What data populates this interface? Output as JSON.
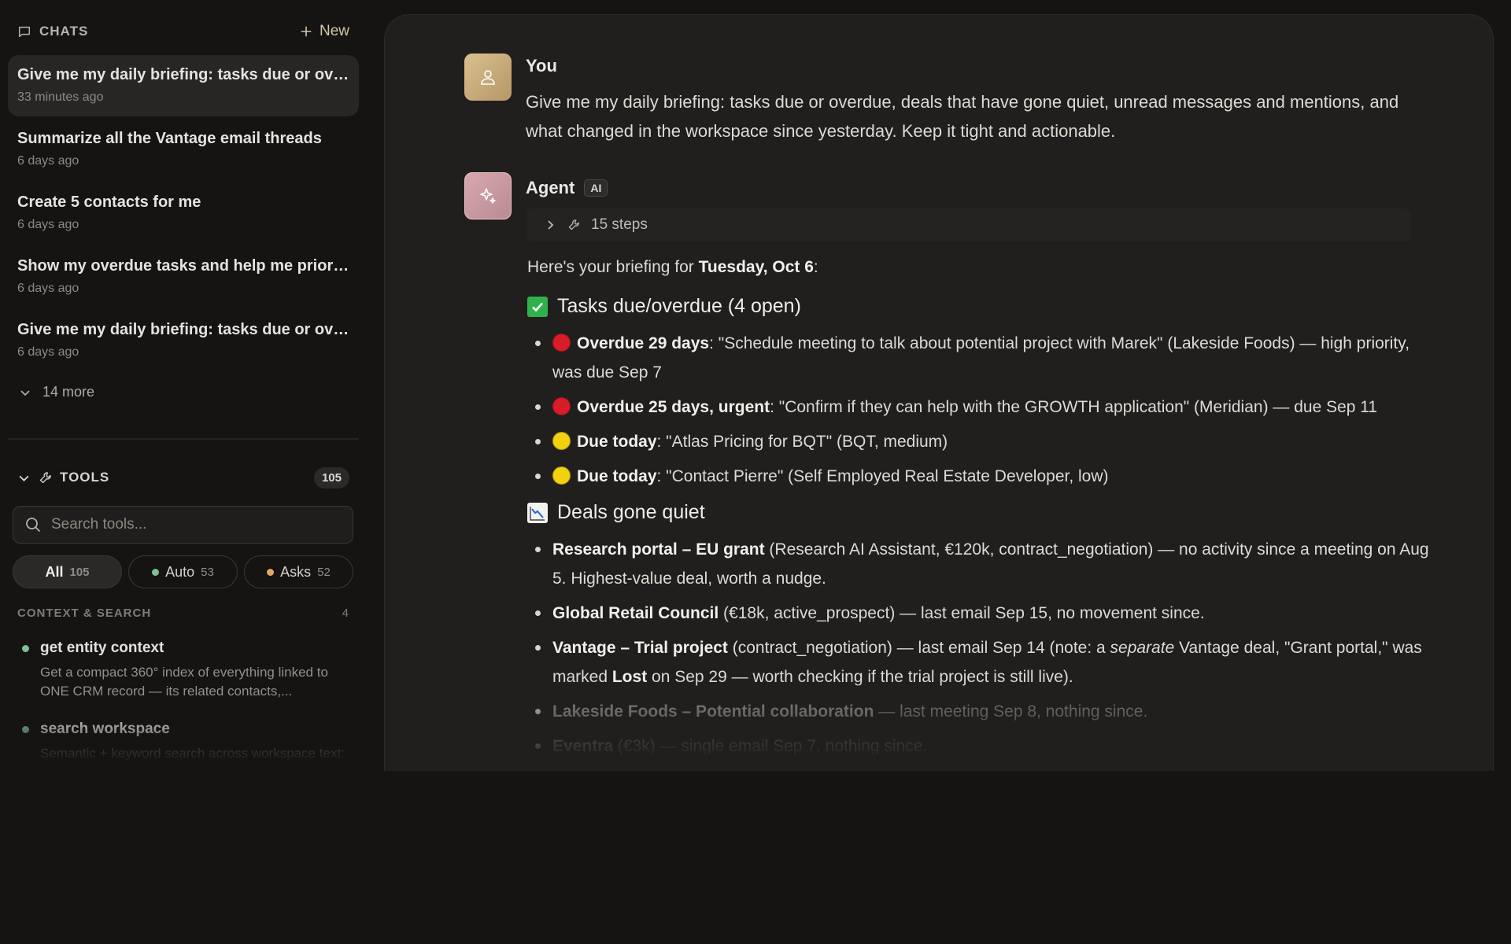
{
  "sidebar": {
    "chats_title": "CHATS",
    "new_label": "New",
    "chats": [
      {
        "title": "Give me my daily briefing: tasks due or ove...",
        "time": "33 minutes ago",
        "active": true
      },
      {
        "title": "Summarize all the Vantage email threads",
        "time": "6 days ago"
      },
      {
        "title": "Create 5 contacts for me",
        "time": "6 days ago"
      },
      {
        "title": "Show my overdue tasks and help me priori...",
        "time": "6 days ago"
      },
      {
        "title": "Give me my daily briefing: tasks due or ove...",
        "time": "6 days ago"
      }
    ],
    "more_label": "14 more",
    "tools_title": "TOOLS",
    "tools_count": "105",
    "search_placeholder": "Search tools...",
    "filters": [
      {
        "label": "All",
        "count": "105"
      },
      {
        "label": "Auto",
        "count": "53",
        "color": "#7fbf9a"
      },
      {
        "label": "Asks",
        "count": "52",
        "color": "#e0a85a"
      }
    ],
    "section": {
      "label": "CONTEXT & SEARCH",
      "count": "4"
    },
    "tools": [
      {
        "name": "get entity context",
        "desc": "Get a compact 360° index of everything linked to ONE CRM record — its related contacts,..."
      },
      {
        "name": "search workspace",
        "desc": "Semantic + keyword search across workspace text: notes, email messages, chat, canvases, an..."
      }
    ]
  },
  "conversation": {
    "user": {
      "name": "You",
      "message": "Give me my daily briefing: tasks due or overdue, deals that have gone quiet, unread messages and mentions, and what changed in the workspace since yesterday. Keep it tight and actionable."
    },
    "agent": {
      "name": "Agent",
      "badge": "AI",
      "steps_label": "15 steps",
      "intro_prefix": "Here's your briefing for ",
      "intro_date": "Tuesday, Oct 6",
      "intro_suffix": ":",
      "tasks_heading": "Tasks due/overdue (4 open)",
      "tasks": [
        {
          "status": "red",
          "label": "Overdue 29 days",
          "text": ": \"Schedule meeting to talk about potential project with Marek\" (Lakeside Foods) — high priority, was due Sep 7"
        },
        {
          "status": "red",
          "label": "Overdue 25 days, urgent",
          "text": ": \"Confirm if they can help with the GROWTH application\" (Meridian) — due Sep 11"
        },
        {
          "status": "yellow",
          "label": "Due today",
          "text": ": \"Atlas Pricing for BQT\" (BQT, medium)"
        },
        {
          "status": "yellow",
          "label": "Due today",
          "text": ": \"Contact Pierre\" (Self Employed Real Estate Developer, low)"
        }
      ],
      "deals_heading": "Deals gone quiet",
      "deals": [
        {
          "name": "Research portal – EU grant",
          "text": " (Research AI Assistant, €120k, contract_negotiation) — no activity since a meeting on Aug 5. Highest-value deal, worth a nudge."
        },
        {
          "name": "Global Retail Council",
          "text": " (€18k, active_prospect) — last email Sep 15, no movement since."
        },
        {
          "name": "Vantage – Trial project",
          "text_a": " (contract_negotiation) — last email Sep 14 (note: a ",
          "em": "separate",
          "text_b": " Vantage deal, \"Grant portal,\" was marked ",
          "bold2": "Lost",
          "text_c": " on Sep 29 — worth checking if the trial project is still live)."
        },
        {
          "name": "Lakeside Foods – Potential collaboration",
          "text": " — last meeting Sep 8, nothing since."
        },
        {
          "name": "Eventra",
          "text": " (€3k) — single email Sep 7, nothing since."
        }
      ]
    }
  }
}
